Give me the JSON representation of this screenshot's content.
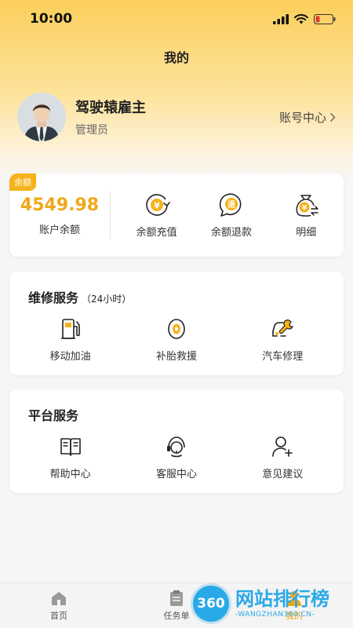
{
  "status_bar": {
    "time": "10:00"
  },
  "header": {
    "title": "我的"
  },
  "profile": {
    "name": "驾驶辕雇主",
    "role": "管理员",
    "account_link": "账号中心"
  },
  "balance": {
    "badge": "余额",
    "value": "4549.98",
    "label": "账户余额",
    "actions": [
      {
        "label": "余额充值",
        "icon": "yuan-recharge-icon"
      },
      {
        "label": "余额退款",
        "icon": "refund-icon"
      },
      {
        "label": "明细",
        "icon": "money-bag-icon"
      }
    ]
  },
  "repair_service": {
    "title": "维修服务",
    "subtitle": "（24小时）",
    "items": [
      {
        "label": "移动加油",
        "icon": "fuel-pump-icon"
      },
      {
        "label": "补胎救援",
        "icon": "tire-icon"
      },
      {
        "label": "汽车修理",
        "icon": "car-repair-icon"
      }
    ]
  },
  "platform_service": {
    "title": "平台服务",
    "items": [
      {
        "label": "帮助中心",
        "icon": "book-icon"
      },
      {
        "label": "客服中心",
        "icon": "headset-icon"
      },
      {
        "label": "意见建议",
        "icon": "user-add-icon"
      }
    ]
  },
  "tabbar": {
    "tabs": [
      {
        "label": "首页",
        "icon": "home-icon"
      },
      {
        "label": "任务单",
        "icon": "clipboard-icon"
      },
      {
        "label": "我的",
        "icon": "person-icon",
        "active": true
      }
    ]
  },
  "watermark": {
    "badge": "360",
    "title": "网站排行榜",
    "subtitle": "-WANGZHAN360.CN-"
  },
  "colors": {
    "accent": "#f0a81a",
    "badge": "#f5b21a",
    "watermark": "#2aa9e8"
  }
}
